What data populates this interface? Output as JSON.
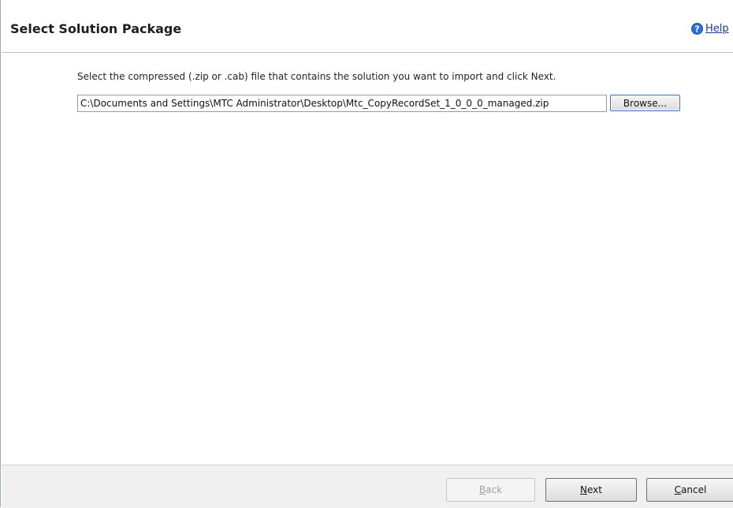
{
  "header": {
    "title": "Select Solution Package",
    "help_label": "Help"
  },
  "content": {
    "instruction": "Select the compressed (.zip or .cab) file that contains the solution you want to import and click Next.",
    "file_path_value": "C:\\Documents and Settings\\MTC Administrator\\Desktop\\Mtc_CopyRecordSet_1_0_0_0_managed.zip",
    "browse_label": "Browse..."
  },
  "footer": {
    "back": {
      "accel": "B",
      "rest": "ack",
      "enabled": false
    },
    "next": {
      "accel": "N",
      "rest": "ext",
      "enabled": true
    },
    "cancel": {
      "accel": "C",
      "rest": "ancel",
      "enabled": true
    }
  },
  "colors": {
    "help_icon": "#2f6fd0",
    "link": "#1a3c8c",
    "footer_bg": "#f0f0f0",
    "focus_border": "#3d6fb6"
  },
  "icons": {
    "help": "question-circle-icon"
  }
}
